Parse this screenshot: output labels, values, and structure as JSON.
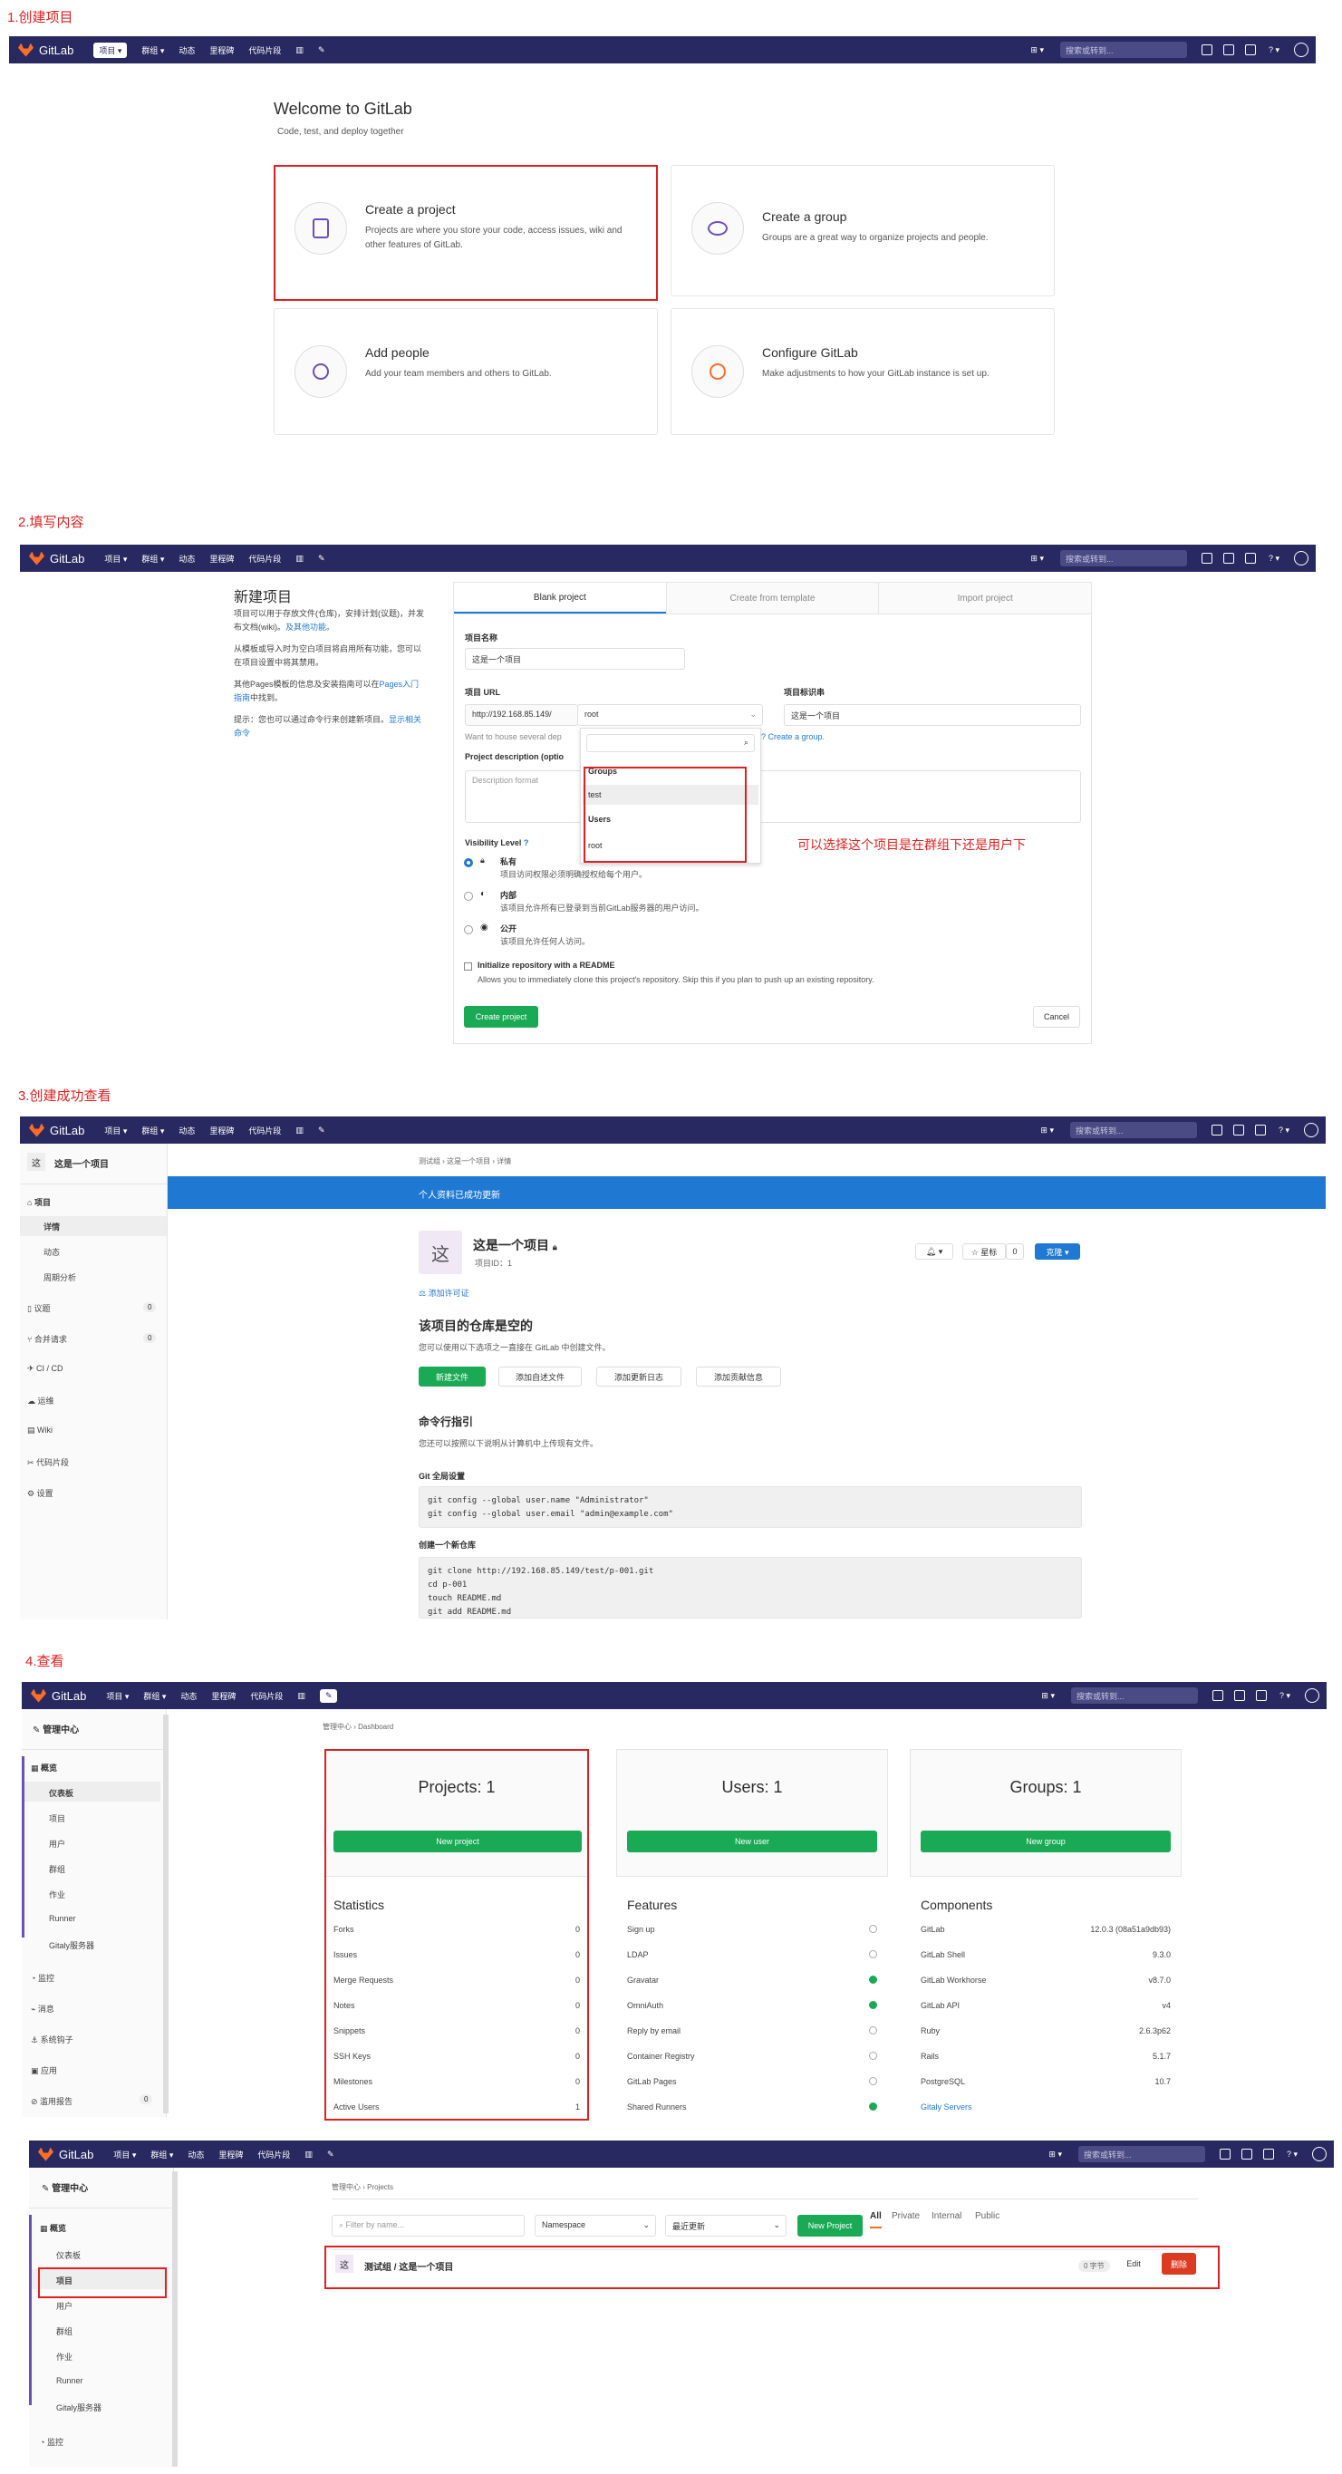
{
  "steps": {
    "s1": "1.创建项目",
    "s2": "2.填写内容",
    "s3": "3.创建成功查看",
    "s4": "4.查看"
  },
  "nav": {
    "brand": "GitLab",
    "projects": "项目 ▾",
    "groups": "群组 ▾",
    "activity": "动态",
    "milestones": "里程碑",
    "snippets": "代码片段",
    "search_placeholder": "搜索或转到..."
  },
  "welcome": {
    "title": "Welcome to GitLab",
    "subtitle": "Code, test, and deploy together",
    "cards": [
      {
        "title": "Create a project",
        "desc": "Projects are where you store your code, access issues, wiki and other features of GitLab."
      },
      {
        "title": "Create a group",
        "desc": "Groups are a great way to organize projects and people."
      },
      {
        "title": "Add people",
        "desc": "Add your team members and others to GitLab."
      },
      {
        "title": "Configure GitLab",
        "desc": "Make adjustments to how your GitLab instance is set up."
      }
    ]
  },
  "newproj": {
    "title": "新建项目",
    "p1": "项目可以用于存放文件(仓库)，安排计划(议题)，并发布文档(wiki)。",
    "p1_link": "及其他功能。",
    "p2": "从模板或导入时为空白项目将启用所有功能，您可以在项目设置中将其禁用。",
    "p3": "其他Pages模板的信息及安装指南可以在",
    "p3_link": "Pages入门指南",
    "p3_end": "中找到。",
    "p4": "提示：您也可以通过命令行来创建新项目。",
    "p4_link": "显示相关命令",
    "tabs": [
      "Blank project",
      "Create from template",
      "Import project"
    ],
    "name_label": "项目名称",
    "name_value": "这是一个项目",
    "url_label": "项目 URL",
    "url_prefix": "http://192.168.85.149/",
    "url_ns": "root",
    "slug_label": "项目标识串",
    "slug_value": "这是一个项目",
    "want_house": "Want to house several dep",
    "create_group": "? Create a group.",
    "desc_label": "Project description (optio",
    "desc_placeholder": "Description format",
    "dropdown": [
      "Groups",
      "test",
      "Users",
      "root"
    ],
    "annotation": "可以选择这个项目是在群组下还是用户下",
    "vis_label": "Visibility Level",
    "vis": [
      {
        "name": "私有",
        "desc": "项目访问权限必须明确授权给每个用户。"
      },
      {
        "name": "内部",
        "desc": "该项目允许所有已登录到当前GitLab服务器的用户访问。"
      },
      {
        "name": "公开",
        "desc": "该项目允许任何人访问。"
      }
    ],
    "readme": "Initialize repository with a README",
    "readme_desc": "Allows you to immediately clone this project's repository. Skip this if you plan to push up an existing repository.",
    "create_btn": "Create project",
    "cancel_btn": "Cancel"
  },
  "proj": {
    "sidebar_title": "这是一个项目",
    "avatar": "这",
    "side": [
      "项目",
      "详情",
      "动态",
      "周期分析",
      "议题",
      "合并请求",
      "CI / CD",
      "运维",
      "Wiki",
      "代码片段",
      "设置"
    ],
    "issues_count": "0",
    "mr_count": "0",
    "breadcrumb": "测试组 › 这是一个项目 › 详情",
    "banner": "个人资料已成功更新",
    "name": "这是一个项目",
    "id": "项目ID：1",
    "star": "☆ 星标",
    "star_count": "0",
    "clone": "克隆 ▾",
    "license": "添加许可证",
    "empty_title": "该项目的仓库是空的",
    "empty_desc": "您可以使用以下选项之一直接在 GitLab 中创建文件。",
    "actions": [
      "新建文件",
      "添加自述文件",
      "添加更新日志",
      "添加贡献信息"
    ],
    "cli_title": "命令行指引",
    "cli_desc": "您还可以按照以下说明从计算机中上传现有文件。",
    "git_global": "Git 全局设置",
    "code1": "git config --global user.name \"Administrator\"\ngit config --global user.email \"admin@example.com\"",
    "new_repo": "创建一个新仓库",
    "code2": "git clone http://192.168.85.149/test/p-001.git\ncd p-001\ntouch README.md\ngit add README.md"
  },
  "admin": {
    "title": "管理中心",
    "side": [
      "概览",
      "仪表板",
      "项目",
      "用户",
      "群组",
      "作业",
      "Runner",
      "Gitaly服务器",
      "监控",
      "消息",
      "系统钩子",
      "应用",
      "滥用报告"
    ],
    "abuse_count": "0",
    "breadcrumb": "管理中心 › Dashboard",
    "projects": "Projects: 1",
    "users": "Users: 1",
    "groups": "Groups: 1",
    "new_project": "New project",
    "new_user": "New user",
    "new_group": "New group",
    "stats_title": "Statistics",
    "stats": [
      [
        "Forks",
        "0"
      ],
      [
        "Issues",
        "0"
      ],
      [
        "Merge Requests",
        "0"
      ],
      [
        "Notes",
        "0"
      ],
      [
        "Snippets",
        "0"
      ],
      [
        "SSH Keys",
        "0"
      ],
      [
        "Milestones",
        "0"
      ],
      [
        "Active Users",
        "1"
      ]
    ],
    "features_title": "Features",
    "features": [
      [
        "Sign up",
        "off"
      ],
      [
        "LDAP",
        "off"
      ],
      [
        "Gravatar",
        "on"
      ],
      [
        "OmniAuth",
        "on"
      ],
      [
        "Reply by email",
        "off"
      ],
      [
        "Container Registry",
        "off"
      ],
      [
        "GitLab Pages",
        "off"
      ],
      [
        "Shared Runners",
        "on"
      ]
    ],
    "components_title": "Components",
    "components": [
      [
        "GitLab",
        "12.0.3 (08a51a9db93)"
      ],
      [
        "GitLab Shell",
        "9.3.0"
      ],
      [
        "GitLab Workhorse",
        "v8.7.0"
      ],
      [
        "GitLab API",
        "v4"
      ],
      [
        "Ruby",
        "2.6.3p62"
      ],
      [
        "Rails",
        "5.1.7"
      ],
      [
        "PostgreSQL",
        "10.7"
      ],
      [
        "Gitaly Servers",
        ""
      ]
    ]
  },
  "plist": {
    "breadcrumb": "管理中心 › Projects",
    "filter_placeholder": "Filter by name...",
    "namespace": "Namespace",
    "sort": "最近更新",
    "new_project": "New Project",
    "tabs": [
      "All",
      "Private",
      "Internal",
      "Public"
    ],
    "row_avatar": "这",
    "row_name": "测试组 / 这是一个项目",
    "row_size": "0 字节",
    "edit": "Edit",
    "delete": "删除"
  }
}
